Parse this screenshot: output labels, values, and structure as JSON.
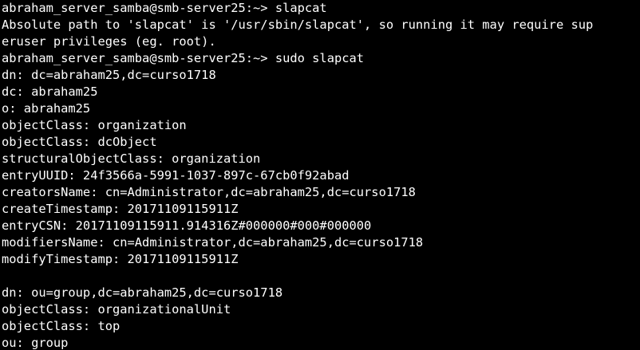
{
  "terminal": {
    "foreground": "#ffffff",
    "background": "#000000",
    "lines": [
      "abraham_server_samba@smb-server25:~> slapcat",
      "Absolute path to 'slapcat' is '/usr/sbin/slapcat', so running it may require sup",
      "eruser privileges (eg. root).",
      "abraham_server_samba@smb-server25:~> sudo slapcat",
      "dn: dc=abraham25,dc=curso1718",
      "dc: abraham25",
      "o: abraham25",
      "objectClass: organization",
      "objectClass: dcObject",
      "structuralObjectClass: organization",
      "entryUUID: 24f3566a-5991-1037-897c-67cb0f92abad",
      "creatorsName: cn=Administrator,dc=abraham25,dc=curso1718",
      "createTimestamp: 20171109115911Z",
      "entryCSN: 20171109115911.914316Z#000000#000#000000",
      "modifiersName: cn=Administrator,dc=abraham25,dc=curso1718",
      "modifyTimestamp: 20171109115911Z",
      "",
      "dn: ou=group,dc=abraham25,dc=curso1718",
      "objectClass: organizationalUnit",
      "objectClass: top",
      "ou: group"
    ]
  }
}
